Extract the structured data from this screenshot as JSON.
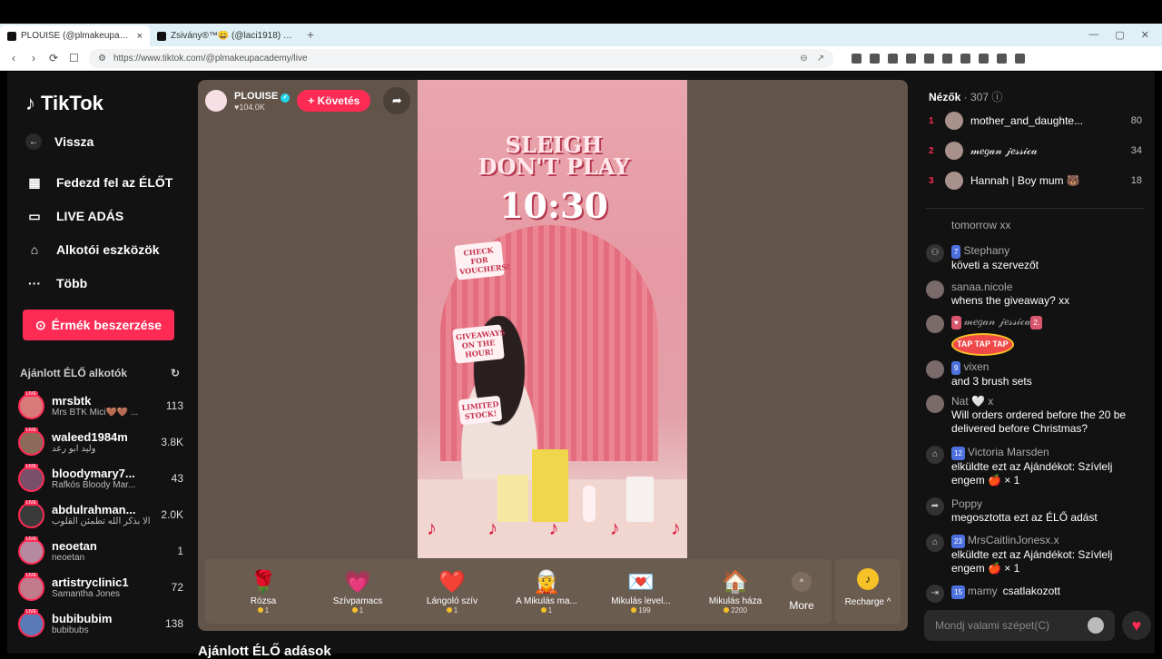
{
  "browser": {
    "tabs": [
      {
        "title": "PLOUISE (@plmakeupacademy) ...",
        "active": true,
        "close": "×"
      },
      {
        "title": "Zsivány®™😄 (@laci1918) ÉLŐ ...",
        "active": false,
        "close": ""
      }
    ],
    "new_tab": "+",
    "window_controls": [
      "—",
      "▢",
      "✕"
    ],
    "url": "https://www.tiktok.com/@plmakeupacademy/live",
    "nav": {
      "back": "‹",
      "forward": "›",
      "reload": "⟳",
      "bookmark": "☐"
    }
  },
  "sidebar": {
    "brand": "TikTok",
    "back_label": "Vissza",
    "items": [
      {
        "label": "Fedezd fel az ÉLŐT",
        "icon": "calendar-live-icon"
      },
      {
        "label": "LIVE ADÁS",
        "icon": "camera-icon"
      },
      {
        "label": "Alkotói eszközök",
        "icon": "creator-tools-icon"
      },
      {
        "label": "Több",
        "icon": "more-icon"
      }
    ],
    "coins_button": "Érmék beszerzése",
    "recommended_title": "Ajánlott ÉLŐ alkotók",
    "creators": [
      {
        "name": "mrsbtk",
        "sub": "Mrs BTK Mici🤎🤎 ...",
        "count": "113",
        "color": "#d97a7a"
      },
      {
        "name": "waleed1984m",
        "sub": "وليد ابو رعد",
        "count": "3.8K",
        "color": "#8c6a5a"
      },
      {
        "name": "bloodymary7...",
        "sub": "Rafkós Bloody Mar...",
        "count": "43",
        "color": "#7a4f6a"
      },
      {
        "name": "abdulrahman...",
        "sub": "ألا بذكر الله تطمئن القلوب",
        "count": "2.0K",
        "color": "#3a3a3a"
      },
      {
        "name": "neoetan",
        "sub": "neoetan",
        "count": "1",
        "color": "#b58aa0"
      },
      {
        "name": "artistryclinic1",
        "sub": "Samantha Jones",
        "count": "72",
        "color": "#c07c8c"
      },
      {
        "name": "bubibubim",
        "sub": "bubibubs",
        "count": "138",
        "color": "#5a7ab8"
      }
    ]
  },
  "stream": {
    "host_name": "PLOUISE",
    "host_likes": "♥104.0K",
    "follow_label": "+ Követés",
    "share_icon": "share-icon",
    "overlay_title": "SLEIGH DON'T PLAY",
    "overlay_time": "10:30",
    "signs": [
      "CHECK FOR VOUCHERS!",
      "GIVEAWAYS ON THE HOUR!",
      "LIMITED STOCK!"
    ]
  },
  "gifts": [
    {
      "name": "Rózsa",
      "price": "1",
      "icon": "🌹"
    },
    {
      "name": "Szívpamacs",
      "price": "1",
      "icon": "💗"
    },
    {
      "name": "Lángoló szív",
      "price": "1",
      "icon": "❤️"
    },
    {
      "name": "A Mikulás ma...",
      "price": "1",
      "icon": "🧝"
    },
    {
      "name": "Mikulás level...",
      "price": "199",
      "icon": "💌"
    },
    {
      "name": "Mikulás háza",
      "price": "2200",
      "icon": "🏠"
    }
  ],
  "more_label": "More",
  "recharge_label": "Recharge ^",
  "below_title": "Ajánlott ÉLŐ adások",
  "chat": {
    "viewers_title": "Nézők",
    "viewers_count": "· 307",
    "top_viewers": [
      {
        "rank": "1",
        "name": "mother_and_daughte...",
        "points": "80"
      },
      {
        "rank": "2",
        "name": "𝓂𝑒𝑔𝒶𝓃 𝒿𝑒𝓈𝓈𝒾𝒸𝒶",
        "points": "34"
      },
      {
        "rank": "3",
        "name": "Hannah | Boy mum 🐻",
        "points": "18"
      }
    ],
    "messages": [
      {
        "icon": "",
        "who": "",
        "text": "tomorrow xx"
      },
      {
        "icon": "follow-icon",
        "level": "7",
        "who": "Stephany",
        "text": "követi a szervezőt"
      },
      {
        "icon": "",
        "who": "sanaa.nicole",
        "text": "whens the giveaway? xx"
      },
      {
        "icon": "",
        "fan": "♥",
        "who": "𝓂𝑒𝑔𝒶𝓃 𝒿𝑒𝓈𝓈𝒾𝒸𝒶",
        "badge": "2.",
        "text": "TAP TAP TAP"
      },
      {
        "icon": "",
        "level": "9",
        "who": "vixen",
        "text": "and 3 brush sets"
      },
      {
        "icon": "",
        "who": "Nat 🤍 x",
        "text": "Will orders ordered before the 20 be delivered before Christmas?"
      },
      {
        "icon": "gift-icon",
        "level": "12",
        "who": "Victoria Marsden",
        "text": "elküldte ezt az Ajándékot: Szívlelj engem 🍎 × 1"
      },
      {
        "icon": "share-icon",
        "who": "Poppy",
        "text": "megosztotta ezt az ÉLŐ adást"
      },
      {
        "icon": "gift-icon",
        "level": "23",
        "who": "MrsCaitlinJonesx.x",
        "text": "elküldte ezt az Ajándékot: Szívlelj engem 🍎 × 1"
      },
      {
        "icon": "join-icon",
        "level": "15",
        "who": "mamy",
        "text": "csatlakozott"
      }
    ],
    "input_placeholder": "Mondj valami szépet(C)"
  }
}
